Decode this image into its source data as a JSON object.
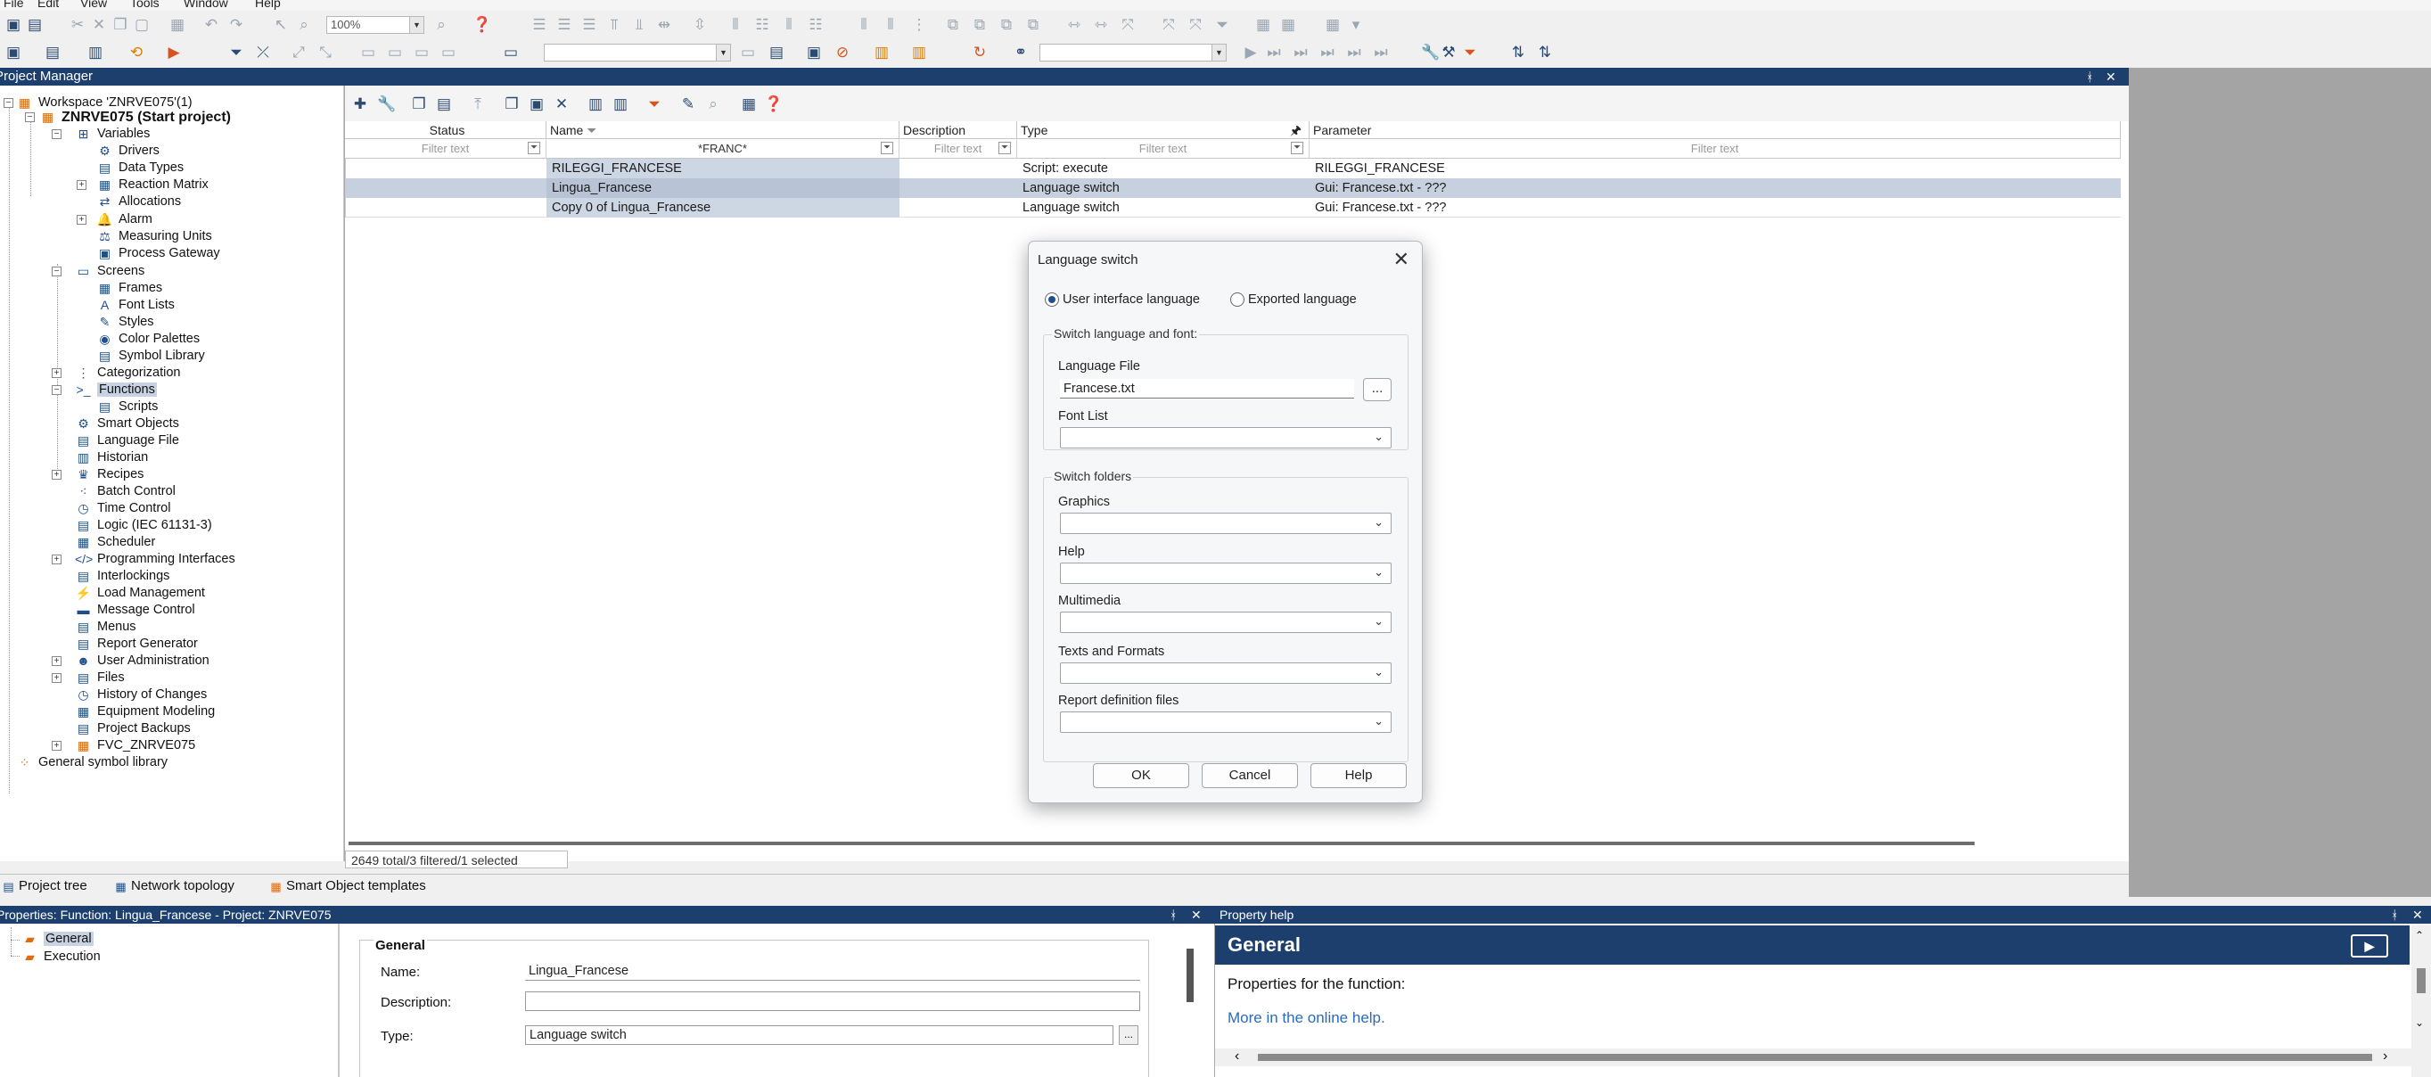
{
  "menu": [
    "File",
    "Edit",
    "View",
    "Tools",
    "Window",
    "Help"
  ],
  "toolbar": {
    "zoom_value": "100%"
  },
  "project_manager": {
    "title": "Project Manager",
    "pin": "ᚼ",
    "close": "✕"
  },
  "tree": {
    "workspace": "Workspace 'ZNRVE075'(1)",
    "project": "ZNRVE075 (Start project)",
    "variables": "Variables",
    "drivers": "Drivers",
    "data_types": "Data Types",
    "reaction_matrix": "Reaction Matrix",
    "allocations": "Allocations",
    "alarm": "Alarm",
    "measuring_units": "Measuring Units",
    "process_gateway": "Process Gateway",
    "screens": "Screens",
    "frames": "Frames",
    "font_lists": "Font Lists",
    "styles": "Styles",
    "color_palettes": "Color Palettes",
    "symbol_library": "Symbol Library",
    "categorization": "Categorization",
    "functions": "Functions",
    "scripts": "Scripts",
    "smart_objects": "Smart Objects",
    "language_file": "Language File",
    "historian": "Historian",
    "recipes": "Recipes",
    "batch_control": "Batch Control",
    "time_control": "Time Control",
    "logic": "Logic (IEC 61131-3)",
    "scheduler": "Scheduler",
    "programming_interfaces": "Programming Interfaces",
    "interlockings": "Interlockings",
    "load_management": "Load Management",
    "message_control": "Message Control",
    "menus": "Menus",
    "report_generator": "Report Generator",
    "user_administration": "User Administration",
    "files": "Files",
    "history_of_changes": "History of Changes",
    "equipment_modeling": "Equipment Modeling",
    "project_backups": "Project Backups",
    "fvc": "FVC_ZNRVE075",
    "general_symbol_library": "General symbol library"
  },
  "grid": {
    "headers": {
      "status": "Status",
      "name": "Name",
      "description": "Description",
      "type": "Type",
      "parameter": "Parameter"
    },
    "filters": {
      "status": "Filter text",
      "name": "*FRANC*",
      "description": "Filter text",
      "type": "Filter text",
      "parameter": "Filter text"
    },
    "rows": [
      {
        "name": "RILEGGI_FRANCESE",
        "description": "",
        "type": "Script: execute",
        "parameter": "RILEGGI_FRANCESE"
      },
      {
        "name": "Lingua_Francese",
        "description": "",
        "type": "Language switch",
        "parameter": "Gui: Francese.txt - ???"
      },
      {
        "name": "Copy 0 of Lingua_Francese",
        "description": "",
        "type": "Language switch",
        "parameter": "Gui: Francese.txt - ???"
      }
    ],
    "status_text": "2649 total/3 filtered/1 selected"
  },
  "bottom_tabs": [
    "Project tree",
    "Network topology",
    "Smart Object templates"
  ],
  "properties": {
    "title": "Properties: Function: Lingua_Francese - Project: ZNRVE075",
    "tree_general": "General",
    "tree_execution": "Execution",
    "section": "General",
    "name_label": "Name:",
    "name_value": "Lingua_Francese",
    "description_label": "Description:",
    "description_value": "",
    "type_label": "Type:",
    "type_value": "Language switch",
    "ellipsis": "..."
  },
  "property_help": {
    "title": "Property help",
    "heading": "General",
    "text": "Properties for the function:",
    "link": "More in the online help."
  },
  "dialog": {
    "title": "Language switch",
    "radio_ui": "User interface language",
    "radio_exported": "Exported language",
    "group_lang": "Switch language and font:",
    "language_file_label": "Language File",
    "language_file_value": "Francese.txt",
    "ellipsis": "...",
    "font_list_label": "Font List",
    "group_folders": "Switch folders",
    "graphics_label": "Graphics",
    "help_label": "Help",
    "multimedia_label": "Multimedia",
    "texts_label": "Texts and Formats",
    "report_label": "Report definition files",
    "ok": "OK",
    "cancel": "Cancel",
    "help_btn": "Help"
  },
  "colors": {
    "title_bar": "#1c3f6e",
    "selection": "#c7d3e3",
    "accent_orange": "#e07c00"
  }
}
